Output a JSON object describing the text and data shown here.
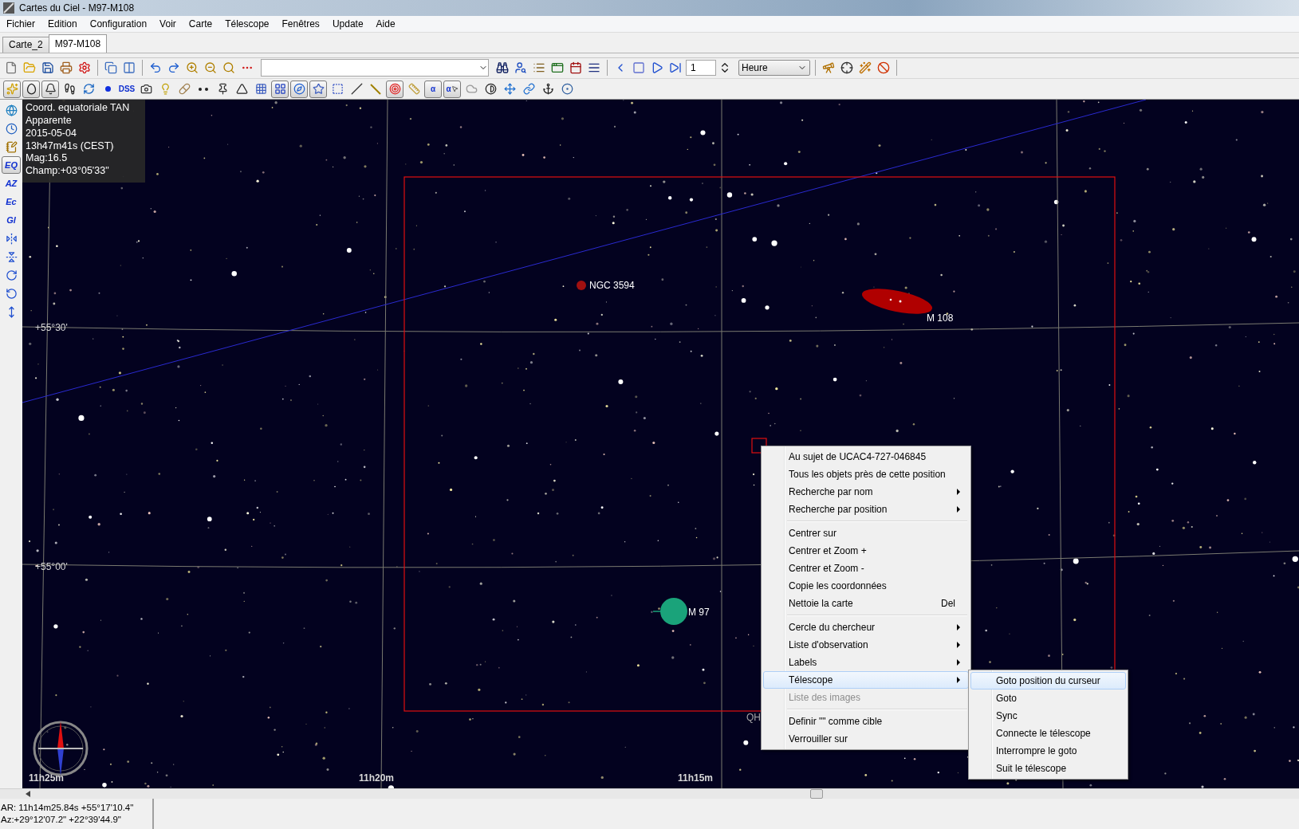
{
  "window": {
    "title": "Cartes du Ciel - M97-M108"
  },
  "menu_bar": [
    "Fichier",
    "Edition",
    "Configuration",
    "Voir",
    "Carte",
    "Télescope",
    "Fenêtres",
    "Update",
    "Aide"
  ],
  "tabs": [
    {
      "label": "Carte_2",
      "selected": false
    },
    {
      "label": "M97-M108",
      "selected": true
    }
  ],
  "toolbar": {
    "spin_value": "1",
    "time_unit": "Heure"
  },
  "toolbar_2": [
    {
      "kind": "sparkles",
      "pressed": true
    },
    {
      "kind": "oval",
      "pressed": true
    },
    {
      "kind": "bell",
      "pressed": true
    },
    {
      "kind": "footprints",
      "pressed": false
    },
    {
      "kind": "swirl",
      "pressed": false
    },
    {
      "kind": "dot",
      "pressed": false
    },
    {
      "kind": "text",
      "label": "DSS",
      "pressed": false
    },
    {
      "kind": "camera",
      "pressed": false
    },
    {
      "kind": "bulb",
      "pressed": false
    },
    {
      "kind": "pill",
      "pressed": false
    },
    {
      "kind": "dots",
      "pressed": false
    },
    {
      "kind": "pin",
      "pressed": false
    },
    {
      "kind": "wedge",
      "pressed": false
    },
    {
      "kind": "grid",
      "pressed": false
    },
    {
      "kind": "grid_eq",
      "pressed": true
    },
    {
      "kind": "compass",
      "pressed": true
    },
    {
      "kind": "star",
      "pressed": true
    },
    {
      "kind": "dashed",
      "pressed": false
    },
    {
      "kind": "slash",
      "pressed": false
    },
    {
      "kind": "line",
      "pressed": false
    },
    {
      "kind": "target",
      "pressed": true
    },
    {
      "kind": "ruler",
      "pressed": false
    },
    {
      "kind": "text",
      "label": "α",
      "pressed": true
    },
    {
      "kind": "text_cursor",
      "label": "α",
      "pressed": true
    },
    {
      "kind": "cloud",
      "pressed": false
    },
    {
      "kind": "contrast",
      "pressed": false
    },
    {
      "kind": "move",
      "pressed": false
    },
    {
      "kind": "link",
      "pressed": false
    },
    {
      "kind": "anchor",
      "pressed": false
    },
    {
      "kind": "circles",
      "pressed": false
    }
  ],
  "sidebar": [
    {
      "kind": "dome",
      "pressed": false
    },
    {
      "kind": "clock",
      "pressed": false
    },
    {
      "kind": "notes",
      "pressed": false
    },
    {
      "kind": "text",
      "label": "EQ",
      "pressed": true
    },
    {
      "kind": "text",
      "label": "AZ",
      "pressed": false
    },
    {
      "kind": "text",
      "label": "Ec",
      "pressed": false
    },
    {
      "kind": "text",
      "label": "Gl",
      "pressed": false
    },
    {
      "kind": "flip_h",
      "pressed": false
    },
    {
      "kind": "flip_v",
      "pressed": false
    },
    {
      "kind": "rotate_cw",
      "pressed": false
    },
    {
      "kind": "rotate_ccw",
      "pressed": false
    },
    {
      "kind": "updown",
      "pressed": false
    }
  ],
  "info_overlay": [
    "Coord. equatoriale TAN",
    "Apparente",
    "2015-05-04",
    "13h47m41s (CEST)",
    "Mag:16.5",
    "Champ:+03°05'33\""
  ],
  "map": {
    "objects": [
      {
        "kind": "galaxy_dot",
        "label": "NGC 3594"
      },
      {
        "kind": "galaxy_ellipse",
        "label": "M 108"
      },
      {
        "kind": "nebula_disc",
        "label": "M 97"
      }
    ],
    "dec_labels": [
      "+55°30'",
      "+55°00'"
    ],
    "ra_labels": [
      "11h25m",
      "11h20m",
      "11h15m"
    ],
    "partial_label": "QH"
  },
  "context_menu": [
    [
      {
        "label": "Au sujet de UCAC4-727-046845",
        "has_submenu": false,
        "selected": false,
        "disabled": false
      },
      {
        "label": "Tous les objets près de cette position",
        "has_submenu": false,
        "selected": false,
        "disabled": false
      },
      {
        "label": "Recherche par nom",
        "has_submenu": true,
        "selected": false,
        "disabled": false
      },
      {
        "label": "Recherche par position",
        "has_submenu": true,
        "selected": false,
        "disabled": false
      }
    ],
    [
      {
        "label": "Centrer sur",
        "has_submenu": false,
        "selected": false,
        "disabled": false
      },
      {
        "label": "Centrer et Zoom +",
        "has_submenu": false,
        "selected": false,
        "disabled": false
      },
      {
        "label": "Centrer et Zoom -",
        "has_submenu": false,
        "selected": false,
        "disabled": false
      },
      {
        "label": "Copie les coordonnées",
        "has_submenu": false,
        "selected": false,
        "disabled": false
      },
      {
        "label": "Nettoie la carte",
        "shortcut": "Del",
        "has_submenu": false,
        "selected": false,
        "disabled": false
      }
    ],
    [
      {
        "label": "Cercle du chercheur",
        "has_submenu": true,
        "selected": false,
        "disabled": false
      },
      {
        "label": "Liste d'observation",
        "has_submenu": true,
        "selected": false,
        "disabled": false
      },
      {
        "label": "Labels",
        "has_submenu": true,
        "selected": false,
        "disabled": false
      },
      {
        "label": "Télescope",
        "has_submenu": true,
        "selected": true,
        "disabled": false
      },
      {
        "label": "Liste des images",
        "has_submenu": false,
        "selected": false,
        "disabled": true
      }
    ],
    [
      {
        "label": "Definir \"\" comme cible",
        "has_submenu": false,
        "selected": false,
        "disabled": false
      },
      {
        "label": "Verrouiller sur",
        "has_submenu": false,
        "selected": false,
        "disabled": false
      }
    ]
  ],
  "submenu": [
    {
      "label": "Goto position du curseur",
      "selected": true
    },
    {
      "label": "Goto",
      "selected": false
    },
    {
      "label": "Sync",
      "selected": false
    },
    {
      "label": "Connecte le télescope",
      "selected": false
    },
    {
      "label": "Interrompre le goto",
      "selected": false
    },
    {
      "label": "Suit le télescope",
      "selected": false
    }
  ],
  "status_bar": [
    "AR: 11h14m25.84s +55°17'10.4\"",
    "Az:+29°12'07.2\" +22°39'44.9\""
  ]
}
